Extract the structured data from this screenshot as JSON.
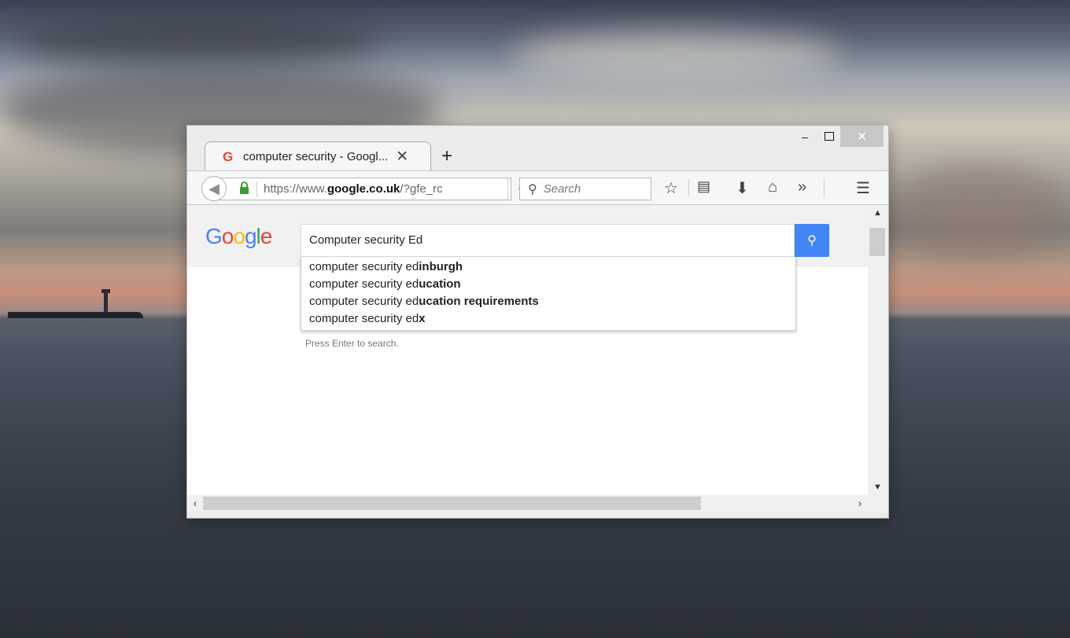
{
  "tab": {
    "favicon": "G",
    "title": "computer security - Googl...",
    "close": "✕",
    "new_tab": "+"
  },
  "window_controls": {
    "minimize": "–",
    "close": "✕"
  },
  "nav": {
    "url_prefix": "https://www.",
    "url_domain": "google.co.uk",
    "url_suffix": "/?gfe_rc",
    "search_placeholder": "Search"
  },
  "toolbar_icons": [
    "star-icon",
    "reading-list-icon",
    "download-icon",
    "home-icon",
    "overflow-icon",
    "menu-icon"
  ],
  "google": {
    "logo": [
      "G",
      "o",
      "o",
      "g",
      "l",
      "e"
    ],
    "query": "Computer security Ed",
    "suggestions": [
      {
        "typed": "computer security ed",
        "completion": "inburgh"
      },
      {
        "typed": "computer security ed",
        "completion": "ucation"
      },
      {
        "typed": "computer security ed",
        "completion": "ucation requirements"
      },
      {
        "typed": "computer security ed",
        "completion": "x"
      }
    ],
    "hint": "Press Enter to search."
  },
  "colors": {
    "accent": "#4285f4",
    "lock": "#3a9c2f"
  }
}
